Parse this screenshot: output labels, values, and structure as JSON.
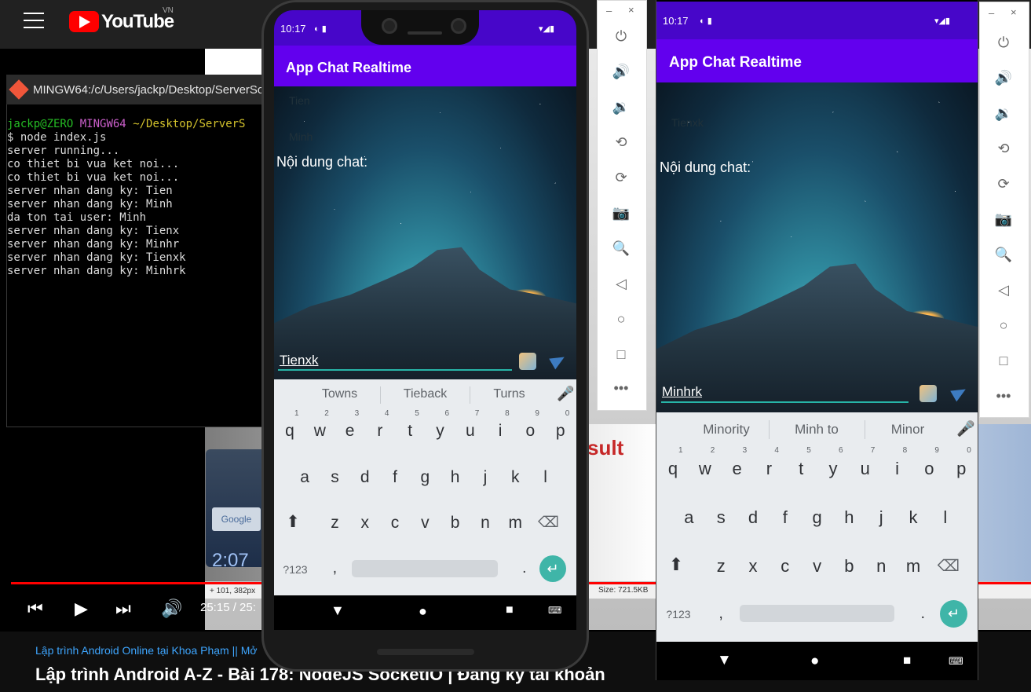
{
  "youtube": {
    "logo": "YouTube",
    "region": "VN",
    "time": "25:15 / 25:",
    "channel": "Lập trình Android Online tại Khoa Phạm || Mở",
    "title": "Lập trình Android A-Z - Bài 178: NodeJS SocketIO | Đăng ký tài khoản",
    "status_left": "+ 101, 382px",
    "status_right": "Size: 721.5KB",
    "video_result": "sult",
    "video_google": "Google",
    "video_clock": "2:07",
    "progress_color": "#ff0000"
  },
  "terminal": {
    "title": "MINGW64:/c/Users/jackp/Desktop/ServerSo",
    "prompt_user": "jackp@ZERO",
    "prompt_env": "MINGW64",
    "prompt_path": "~/Desktop/ServerS",
    "lines": [
      "$ node index.js",
      "server running...",
      "co thiet bi vua ket noi...",
      "co thiet bi vua ket noi...",
      "server nhan dang ky: Tien",
      "server nhan dang ky: Minh",
      "da ton tai user: Minh",
      "server nhan dang ky: Tienx",
      "server nhan dang ky: Minhr",
      "server nhan dang ky: Tienxk",
      "server nhan dang ky: Minhrk"
    ]
  },
  "phone1": {
    "time": "10:17",
    "app_title": "App Chat Realtime",
    "users": [
      "Tien",
      "Minh"
    ],
    "chat_label": "Nội dung chat:",
    "input_value": "Tienxk",
    "suggestions": [
      "Towns",
      "Tieback",
      "Turns"
    ],
    "accent": "#6200ee"
  },
  "phone2": {
    "time": "10:17",
    "app_title": "App Chat Realtime",
    "users": [
      "Tienxk"
    ],
    "chat_label": "Nội dung chat:",
    "input_value": "Minhrk",
    "suggestions": [
      "Minority",
      "Minh to",
      "Minor"
    ],
    "accent": "#6200ee"
  },
  "keyboard": {
    "row1": [
      "q",
      "w",
      "e",
      "r",
      "t",
      "y",
      "u",
      "i",
      "o",
      "p"
    ],
    "row1_nums": [
      "1",
      "2",
      "3",
      "4",
      "5",
      "6",
      "7",
      "8",
      "9",
      "0"
    ],
    "row2": [
      "a",
      "s",
      "d",
      "f",
      "g",
      "h",
      "j",
      "k",
      "l"
    ],
    "row3": [
      "z",
      "x",
      "c",
      "v",
      "b",
      "n",
      "m"
    ],
    "symbols": "?123",
    "comma": ",",
    "period": "."
  },
  "toolbar": {
    "minimize": "–",
    "close": "×",
    "icons": [
      "power-icon",
      "volume-up-icon",
      "volume-down-icon",
      "rotate-left-icon",
      "rotate-right-icon",
      "camera-icon",
      "zoom-icon",
      "back-icon",
      "home-icon",
      "overview-icon",
      "more-icon"
    ]
  }
}
